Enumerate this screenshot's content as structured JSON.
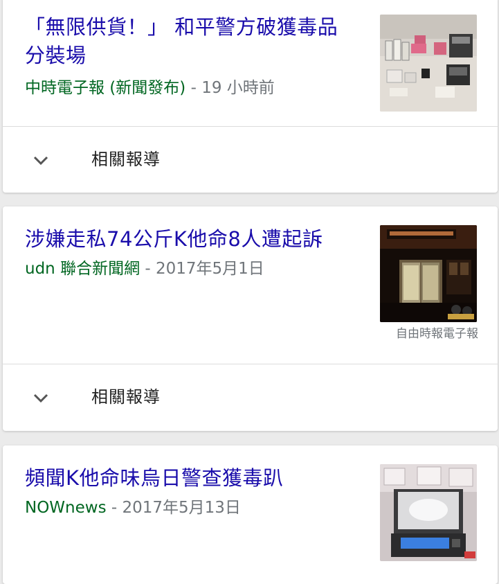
{
  "results": [
    {
      "title": "「無限供貨！」 和平警方破獲毒品分裝場",
      "source": "中時電子報 (新聞發布)",
      "separator": " - ",
      "time": "19 小時前",
      "thumbnail": "drug-packaging-equipment-photo",
      "related_label": "相關報導"
    },
    {
      "title": "涉嫌走私74公斤K他命8人遭起訴",
      "source": "udn 聯合新聞網",
      "separator": " - ",
      "time": "2017年5月1日",
      "thumbnail": "building-entrance-night-photo",
      "image_credit": "自由時報電子報",
      "related_label": "相關報導"
    },
    {
      "title": "頻聞K他命味烏日警查獲毒趴",
      "source": "NOWnews",
      "separator": " - ",
      "time": "2017年5月13日",
      "thumbnail": "digital-scale-powder-photo"
    }
  ],
  "colors": {
    "title": "#1a0dab",
    "source": "#006621",
    "meta": "#70757a",
    "background": "#ebebeb"
  }
}
